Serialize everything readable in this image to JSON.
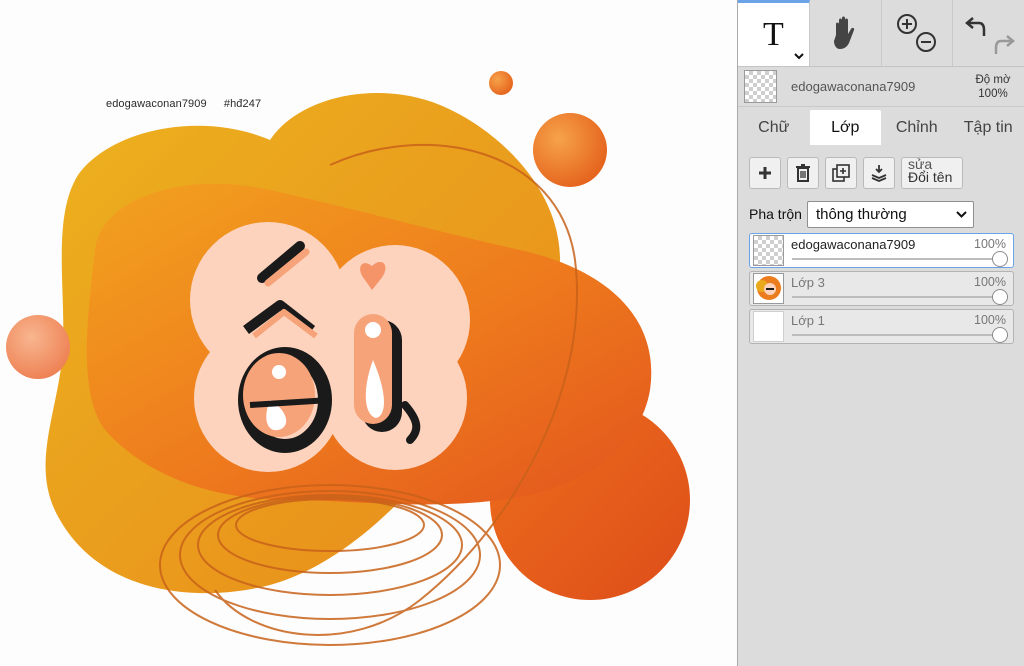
{
  "canvas": {
    "watermark_user": "edogawaconan7909",
    "watermark_tag": "#hđ247",
    "colors": {
      "orange_dark": "#e2541d",
      "orange": "#f28a1f",
      "yellow": "#eaa91d",
      "peach": "#fdd3bd",
      "salmon": "#f7a37a"
    }
  },
  "toolbar": {
    "tools": [
      {
        "name": "text-tool",
        "icon": "text-icon",
        "glyph": "T"
      },
      {
        "name": "pan-tool",
        "icon": "hand-icon"
      },
      {
        "name": "zoom-tool",
        "icon": "zoom-in-out-icon"
      },
      {
        "name": "history-tool",
        "icon": "undo-redo-icon"
      }
    ]
  },
  "layer_header": {
    "name": "edogawaconana7909",
    "opacity_label": "Độ mờ",
    "opacity_value": "100%"
  },
  "tabs": [
    {
      "label": "Chữ",
      "active": false
    },
    {
      "label": "Lớp",
      "active": true
    },
    {
      "label": "Chỉnh",
      "active": false
    },
    {
      "label": "Tập tin",
      "active": false
    }
  ],
  "actions": {
    "rename_line1": "sửa",
    "rename_line2": "Đổi tên"
  },
  "blend": {
    "label": "Pha trộn",
    "selected": "thông thường"
  },
  "layers": [
    {
      "name": "edogawaconana7909",
      "opacity": "100%",
      "selected": true
    },
    {
      "name": "Lớp 3",
      "opacity": "100%",
      "selected": false
    },
    {
      "name": "Lớp 1",
      "opacity": "100%",
      "selected": false
    }
  ]
}
